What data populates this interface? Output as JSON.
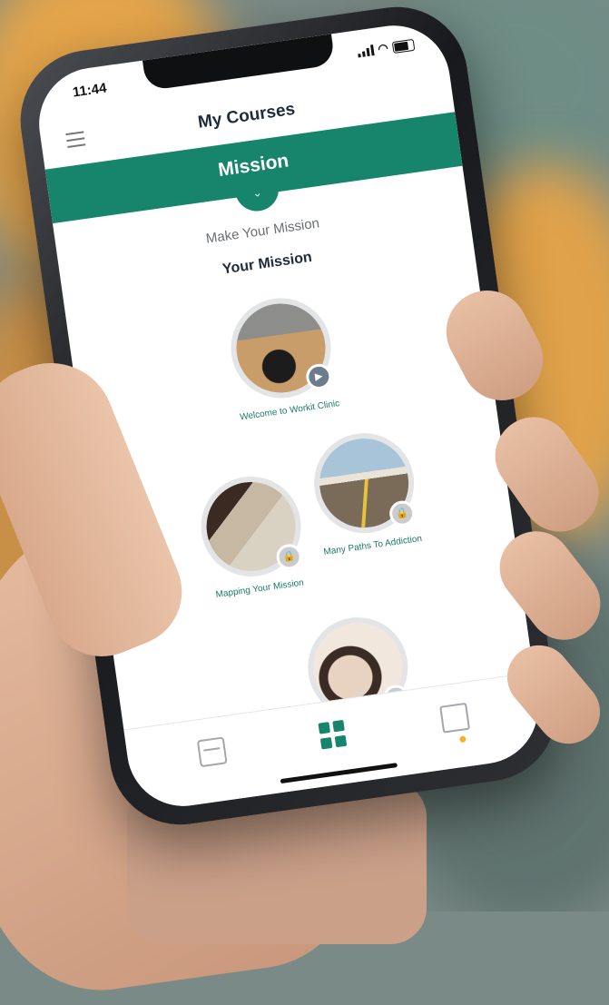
{
  "status": {
    "time": "11:44"
  },
  "header": {
    "title": "My Courses",
    "menu_icon": "menu-icon"
  },
  "banner": {
    "title": "Mission",
    "chevron": "⌄"
  },
  "content": {
    "subtitle": "Make Your Mission",
    "section_title": "Your Mission",
    "lessons": [
      {
        "name": "Welcome to Workit Clinic",
        "state": "play"
      },
      {
        "name": "Mapping Your Mission",
        "state": "locked"
      },
      {
        "name": "Many Paths To Addiction",
        "state": "locked"
      },
      {
        "name": "",
        "state": "locked"
      }
    ]
  },
  "nav": {
    "items": [
      "calendar-icon",
      "grid-icon",
      "chat-icon"
    ],
    "active": "grid-icon"
  },
  "colors": {
    "brand": "#17856b",
    "accent": "#f0b52b"
  }
}
